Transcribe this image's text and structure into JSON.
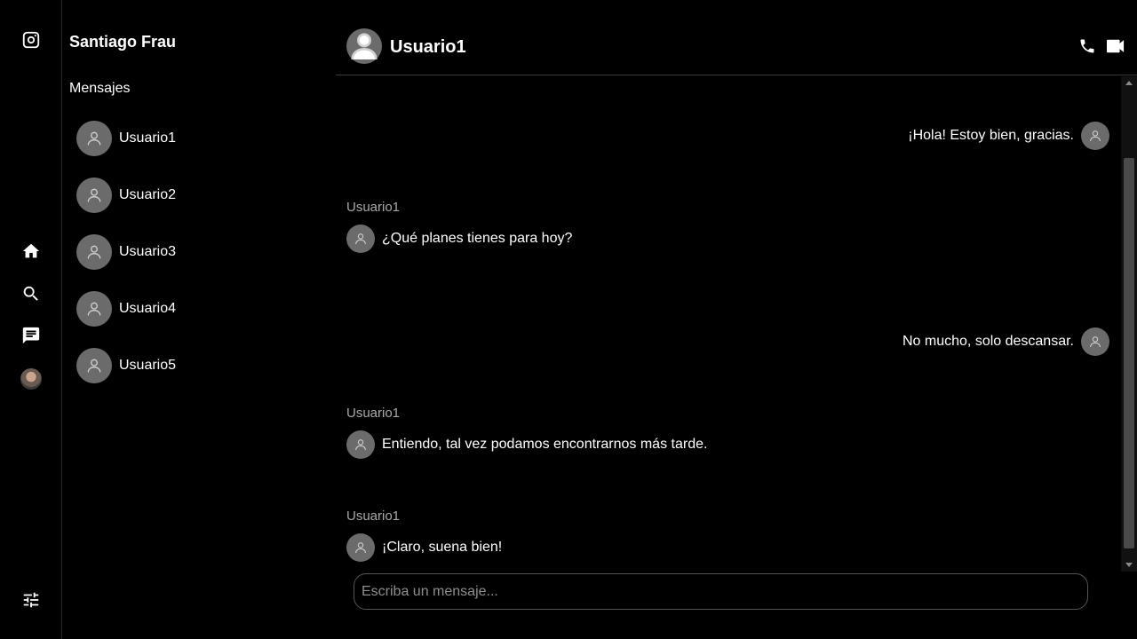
{
  "rail": {
    "icons": [
      "instagram-icon",
      "home-icon",
      "search-icon",
      "messages-icon",
      "profile-avatar",
      "settings-sliders-icon"
    ]
  },
  "panel": {
    "owner_name": "Santiago Frau",
    "section_title": "Mensajes",
    "conversations": [
      {
        "name": "Usuario1"
      },
      {
        "name": "Usuario2"
      },
      {
        "name": "Usuario3"
      },
      {
        "name": "Usuario4"
      },
      {
        "name": "Usuario5"
      }
    ]
  },
  "chat": {
    "title": "Usuario1",
    "messages": [
      {
        "direction": "out",
        "text": "¡Hola! Estoy bien, gracias."
      },
      {
        "direction": "in",
        "sender": "Usuario1",
        "text": "¿Qué planes tienes para hoy?"
      },
      {
        "direction": "out",
        "text": "No mucho, solo descansar."
      },
      {
        "direction": "in",
        "sender": "Usuario1",
        "text": "Entiendo, tal vez podamos encontrarnos más tarde."
      },
      {
        "direction": "in",
        "sender": "Usuario1",
        "text": "¡Claro, suena bien!"
      }
    ],
    "composer_placeholder": "Escriba un mensaje..."
  }
}
